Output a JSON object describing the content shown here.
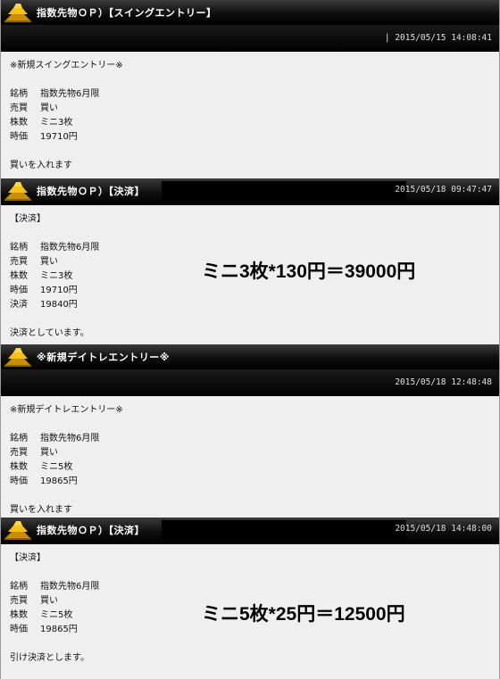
{
  "posts": [
    {
      "title": "指数先物ＯＰ）【スイングエントリー】",
      "date": "| 2015/05/15 14:08:41",
      "heading": "※新規スイングエントリー※",
      "rows": [
        {
          "k": "銘柄",
          "v": "指数先物6月限"
        },
        {
          "k": "売買",
          "v": "買い"
        },
        {
          "k": "株数",
          "v": "ミニ3枚"
        },
        {
          "k": "時価",
          "v": "19710円"
        }
      ],
      "footer": "買いを入れます"
    },
    {
      "title": "指数先物ＯＰ）【決済】",
      "date": "2015/05/18 09:47:47",
      "heading": "【決済】",
      "rows": [
        {
          "k": "銘柄",
          "v": "指数先物6月限"
        },
        {
          "k": "売買",
          "v": "買い"
        },
        {
          "k": "株数",
          "v": "ミニ3枚"
        },
        {
          "k": "時価",
          "v": "19710円"
        },
        {
          "k": "決済",
          "v": "19840円"
        }
      ],
      "footer": "決済としています。",
      "overlay": "ミニ3枚*130円＝39000円"
    },
    {
      "title": "※新規デイトレエントリー※",
      "date": "2015/05/18 12:48:48",
      "heading": "※新規デイトレエントリー※",
      "rows": [
        {
          "k": "銘柄",
          "v": "指数先物6月限"
        },
        {
          "k": "売買",
          "v": "買い"
        },
        {
          "k": "株数",
          "v": "ミニ5枚"
        },
        {
          "k": "時価",
          "v": "19865円"
        }
      ],
      "footer": "買いを入れます"
    },
    {
      "title": "指数先物ＯＰ）【決済】",
      "date": "2015/05/18 14:48:00",
      "heading": "【決済】",
      "rows": [
        {
          "k": "銘柄",
          "v": "指数先物6月限"
        },
        {
          "k": "売買",
          "v": "買い"
        },
        {
          "k": "株数",
          "v": "ミニ5枚"
        },
        {
          "k": "時価",
          "v": "19865円"
        }
      ],
      "footer": "引け決済とします。",
      "overlay": "ミニ5枚*25円＝12500円"
    }
  ],
  "icon": "gold-bars-icon",
  "colors": {
    "header": "#000000",
    "panel": "#efefef",
    "gold": "#e8b200"
  }
}
